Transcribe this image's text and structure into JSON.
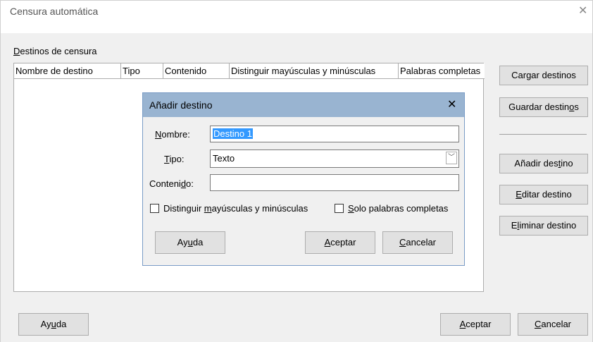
{
  "window": {
    "title": "Censura automática"
  },
  "section_label": "Destinos de censura",
  "table": {
    "columns": [
      "Nombre de destino",
      "Tipo",
      "Contenido",
      "Distinguir mayúsculas y minúsculas",
      "Palabras completas"
    ]
  },
  "side_buttons": {
    "load": "Cargar destinos",
    "save": "Guardar destinos",
    "add": "Añadir destino",
    "edit": "Editar destino",
    "delete": "Eliminar destino"
  },
  "footer": {
    "help": "Ayuda",
    "ok": "Aceptar",
    "cancel": "Cancelar"
  },
  "dialog": {
    "title": "Añadir destino",
    "name_label": "Nombre:",
    "name_value": "Destino 1",
    "type_label": "Tipo:",
    "type_value": "Texto",
    "content_label": "Contenido:",
    "content_value": "",
    "case_checkbox": "Distinguir mayúsculas y minúsculas",
    "case_checked": false,
    "whole_checkbox": "Solo palabras completas",
    "whole_checked": false,
    "help": "Ayuda",
    "ok": "Aceptar",
    "cancel": "Cancelar"
  },
  "colors": {
    "dialog_header": "#99b4d1",
    "selection": "#3399ff",
    "button": "#e1e1e1"
  }
}
